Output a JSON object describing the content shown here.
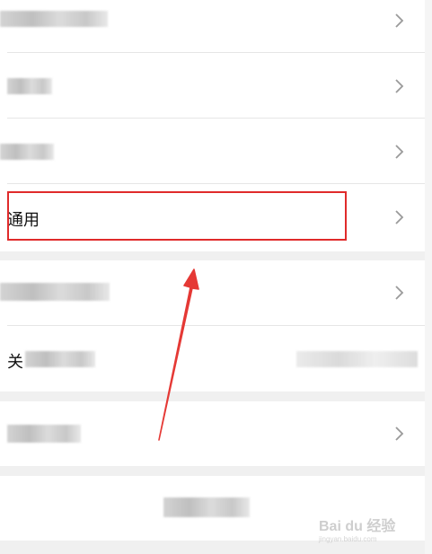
{
  "settings": {
    "rows": [
      {
        "label": "",
        "blurred": true
      },
      {
        "label": "",
        "blurred": true
      },
      {
        "label": "",
        "blurred": true
      },
      {
        "label": "通用"
      },
      {
        "label": "",
        "blurred": true
      },
      {
        "label": "关",
        "blurred": true
      },
      {
        "label": "",
        "blurred": true
      },
      {
        "label": "",
        "blurred": true
      }
    ]
  },
  "watermark": {
    "text": "Bai du 经验",
    "subtext": "jingyan.baidu.com"
  },
  "colors": {
    "highlight": "#e02b2b",
    "arrow": "#e53935"
  }
}
